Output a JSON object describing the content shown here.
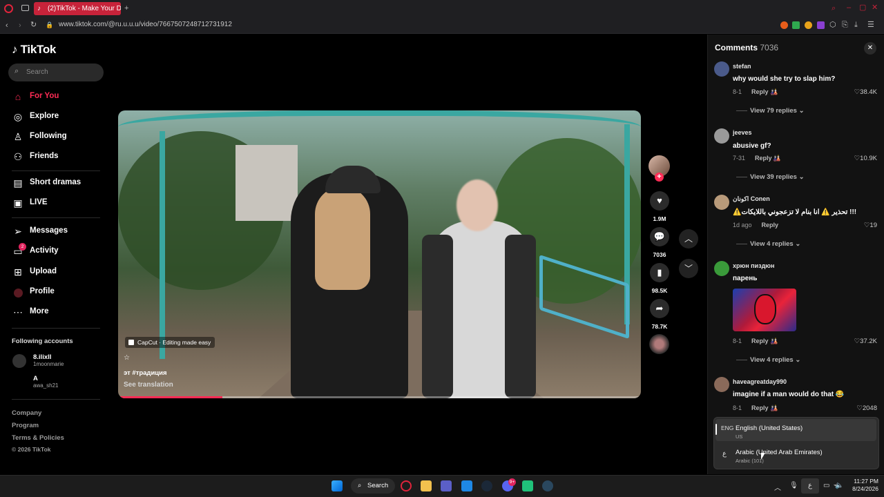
{
  "browser": {
    "tab_title": "(2)TikTok - Make Your D",
    "url": "www.tiktok.com/@ru.u.u.u/video/7667507248712731912",
    "new_tab_icon": "plus-icon"
  },
  "sidebar": {
    "logo": "TikTok",
    "search_placeholder": "Search",
    "nav": [
      {
        "label": "For You",
        "icon": "home-icon",
        "active": true
      },
      {
        "label": "Explore",
        "icon": "compass-icon"
      },
      {
        "label": "Following",
        "icon": "person-follow-icon"
      },
      {
        "label": "Friends",
        "icon": "friends-icon"
      },
      {
        "label": "Short dramas",
        "icon": "film-icon"
      },
      {
        "label": "LIVE",
        "icon": "live-tv-icon"
      },
      {
        "label": "Messages",
        "icon": "paper-plane-icon"
      },
      {
        "label": "Activity",
        "icon": "inbox-icon",
        "badge": "2"
      },
      {
        "label": "Upload",
        "icon": "upload-icon"
      },
      {
        "label": "Profile",
        "icon": "profile-icon"
      },
      {
        "label": "More",
        "icon": "more-icon"
      }
    ],
    "following_title": "Following accounts",
    "accounts": [
      {
        "name": "8.ilixll",
        "handle": "1moonmarie"
      },
      {
        "name": "A",
        "handle": "awa_sh21"
      }
    ],
    "footer": [
      "Company",
      "Program",
      "Terms & Policies",
      "© 2026 TikTok"
    ]
  },
  "video": {
    "capcut_label": "CapCut · Editing made easy",
    "star": "☆",
    "caption": "эт #традиция",
    "see_translation": "See translation",
    "progress": 0.2
  },
  "actions": {
    "likes": "1.9M",
    "comments": "7036",
    "saves": "98.5K",
    "shares": "78.7K"
  },
  "comments": {
    "title": "Comments",
    "count": "7036",
    "items": [
      {
        "user": "stefan",
        "text": "why would she try to slap him?",
        "date": "8-1",
        "reply": "Reply",
        "likes": "38.4K",
        "view_replies": "View 79 replies",
        "avatar_color": "#4a5a8a"
      },
      {
        "user": "jeeves",
        "text": "abusive gf?",
        "date": "7-31",
        "reply": "Reply",
        "likes": "10.9K",
        "view_replies": "View 39 replies",
        "avatar_color": "#9a9a9a"
      },
      {
        "user": "اكونان Conen",
        "text": "⚠️تحذير ⚠️ انا بنام لا تزعجوني باللايكات !!!",
        "date": "1d ago",
        "reply": "Reply",
        "likes": "19",
        "view_replies": "View 4 replies",
        "avatar_color": "#b89a7a"
      },
      {
        "user": "хрюн пиздюн",
        "text": "парень",
        "date": "8-1",
        "reply": "Reply",
        "likes": "37.2K",
        "view_replies": "View 4 replies",
        "avatar_color": "#3a9a3a"
      },
      {
        "user": "haveagreatday990",
        "text": "imagine if a man would do that 😂",
        "date": "8-1",
        "reply": "Reply",
        "likes": "2048",
        "avatar_color": "#8a6a5a"
      }
    ]
  },
  "language_popup": {
    "items": [
      {
        "code": "ENG",
        "name": "English (United States)",
        "sub": "US",
        "selected": true
      },
      {
        "code": "ع",
        "name": "Arabic (United Arab Emirates)",
        "sub": "Arabic (101)"
      }
    ]
  },
  "taskbar": {
    "search_label": "Search",
    "discord_badge": "9+",
    "lang_indicator": "ع",
    "time": "11:27 PM",
    "date": "8/24/2026"
  },
  "colors": {
    "accent": "#fe2c55",
    "tab_active": "#c7233a"
  }
}
